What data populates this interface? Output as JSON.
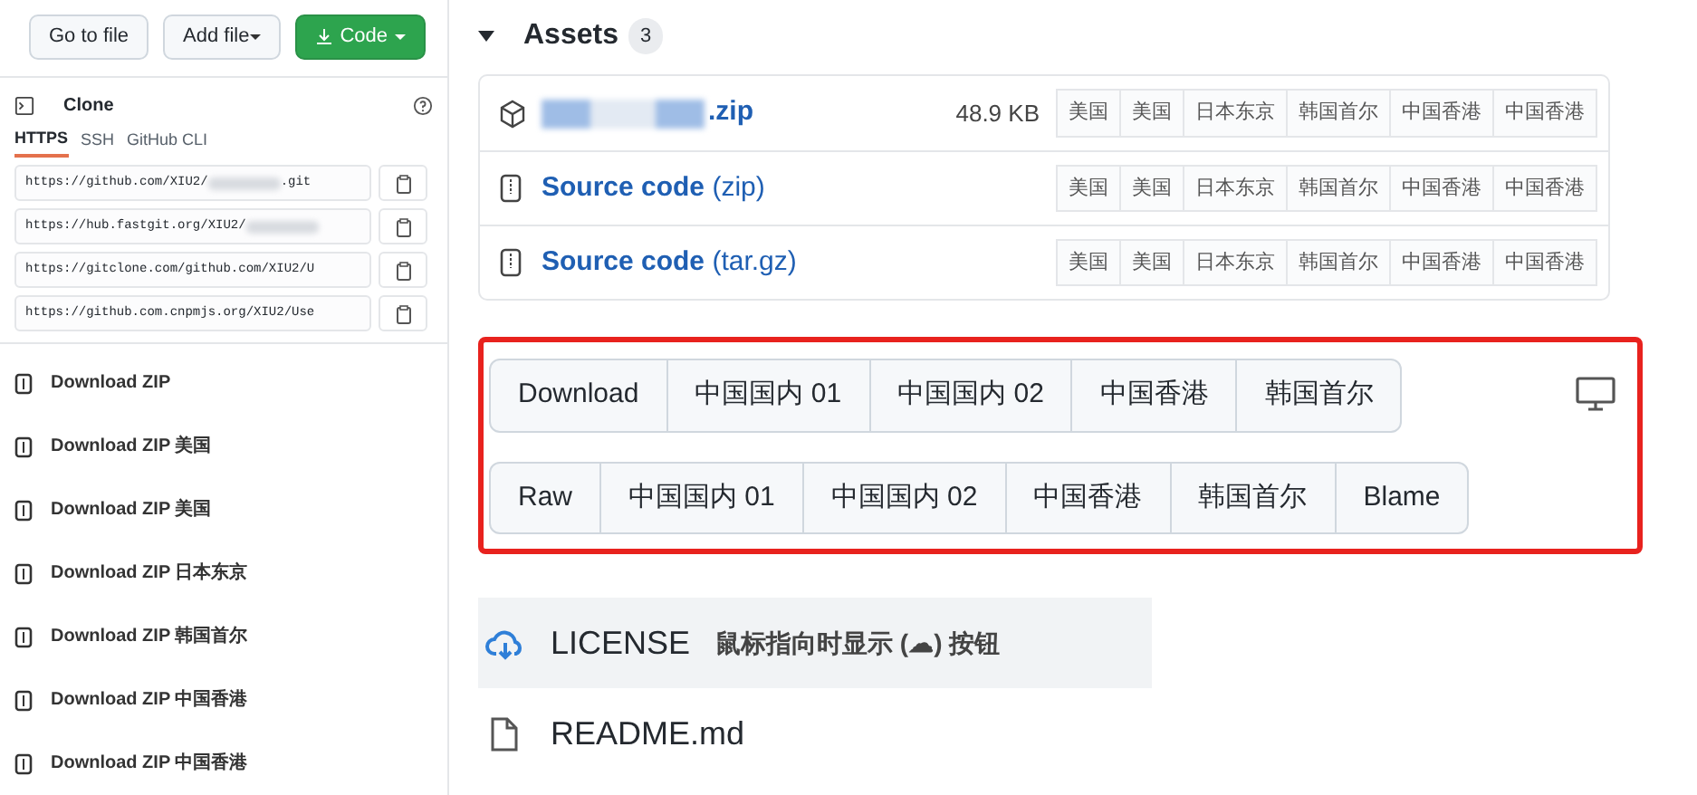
{
  "top_buttons": [
    {
      "label": "Go to file",
      "kind": "plain",
      "caret": false
    },
    {
      "label": "Add file",
      "kind": "plain",
      "caret": true
    },
    {
      "label": "Code",
      "kind": "primary",
      "caret": true
    }
  ],
  "clone": {
    "title": "Clone",
    "tabs": [
      {
        "label": "HTTPS",
        "selected": true
      },
      {
        "label": "SSH",
        "selected": false
      },
      {
        "label": "GitHub CLI",
        "selected": false
      }
    ],
    "urls": [
      {
        "prefix": "https://github.com/XIU2/",
        "redacted": true,
        "suffix": ".git"
      },
      {
        "prefix": "https://hub.fastgit.org/XIU2/",
        "redacted": true
      },
      {
        "prefix": "https://gitclone.com/github.com/XIU2/U",
        "redacted": false
      },
      {
        "prefix": "https://github.com.cnpmjs.org/XIU2/Use",
        "redacted": false
      }
    ]
  },
  "downloads": [
    {
      "label": "Download ZIP"
    },
    {
      "label": "Download ZIP 美国"
    },
    {
      "label": "Download ZIP 美国"
    },
    {
      "label": "Download ZIP 日本东京"
    },
    {
      "label": "Download ZIP 韩国首尔"
    },
    {
      "label": "Download ZIP 中国香港"
    },
    {
      "label": "Download ZIP 中国香港"
    }
  ],
  "assets": {
    "title": "Assets",
    "count": "3",
    "rows": [
      {
        "kind": "package",
        "name": ".zip",
        "redacted": true,
        "size": "48.9 KB",
        "mirrors": [
          "美国",
          "美国",
          "日本东京",
          "韩国首尔",
          "中国香港",
          "中国香港"
        ]
      },
      {
        "kind": "source",
        "name": "Source code",
        "redacted": false,
        "note": "(zip)",
        "mirrors": [
          "美国",
          "美国",
          "日本东京",
          "韩国首尔",
          "中国香港",
          "中国香港"
        ]
      },
      {
        "kind": "source",
        "name": "Source code",
        "redacted": false,
        "note": "(tar.gz)",
        "mirrors": [
          "美国",
          "美国",
          "日本东京",
          "韩国首尔",
          "中国香港",
          "中国香港"
        ]
      }
    ]
  },
  "file_buttons": {
    "row_1": [
      "Download",
      "中国国内 01",
      "中国国内 02",
      "中国香港",
      "韩国首尔"
    ],
    "row_2": [
      "Raw",
      "中国国内 01",
      "中国国内 02",
      "中国香港",
      "韩国首尔",
      "Blame"
    ]
  },
  "files": [
    {
      "kind": "cloud",
      "name": "LICENSE",
      "note": "鼠标指向时显示 (☁) 按钮",
      "hovered": true
    },
    {
      "kind": "file",
      "name": "README.md",
      "hovered": false
    }
  ]
}
